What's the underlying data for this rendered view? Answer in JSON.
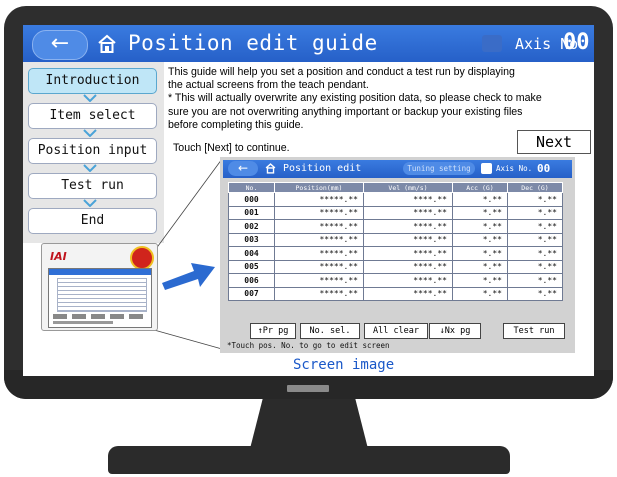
{
  "header": {
    "back_glyph": "←",
    "title": "Position edit guide",
    "axis_label": "Axis No.",
    "axis_no": "00"
  },
  "sidebar": {
    "steps": [
      {
        "label": "Introduction",
        "active": true
      },
      {
        "label": "Item select",
        "active": false
      },
      {
        "label": "Position input",
        "active": false
      },
      {
        "label": "Test run",
        "active": false
      },
      {
        "label": "End",
        "active": false
      }
    ]
  },
  "guide": {
    "line1": "This guide will help you set a position and conduct a test run by displaying",
    "line2": "the actual screens from the teach pendant.",
    "line3": "* This will actually overwrite any existing position data, so please check to make",
    "line4": "sure you are not overwriting anything important or backup your existing files",
    "line5": "before completing this guide.",
    "touch": "Touch [Next] to continue.",
    "next_label": "Next"
  },
  "pendant": {
    "brand": "IAI"
  },
  "preview": {
    "back_glyph": "←",
    "title": "Position edit",
    "tuning": "Tuning setting",
    "axis_label": "Axis No.",
    "axis_no": "00",
    "columns": [
      "No.",
      "Position(mm)",
      "Vel (mm/s)",
      "Acc (G)",
      "Dec (G)"
    ],
    "rows": [
      [
        "000",
        "*****.**",
        "****.**",
        "*.**",
        "*.**"
      ],
      [
        "001",
        "*****.**",
        "****.**",
        "*.**",
        "*.**"
      ],
      [
        "002",
        "*****.**",
        "****.**",
        "*.**",
        "*.**"
      ],
      [
        "003",
        "*****.**",
        "****.**",
        "*.**",
        "*.**"
      ],
      [
        "004",
        "*****.**",
        "****.**",
        "*.**",
        "*.**"
      ],
      [
        "005",
        "*****.**",
        "****.**",
        "*.**",
        "*.**"
      ],
      [
        "006",
        "*****.**",
        "****.**",
        "*.**",
        "*.**"
      ],
      [
        "007",
        "*****.**",
        "****.**",
        "*.**",
        "*.**"
      ]
    ],
    "buttons": {
      "prev_page": "↑Pr pg",
      "no_sel": "No. sel.",
      "all_clear": "All clear",
      "next_page": "↓Nx pg",
      "test_run": "Test run"
    },
    "note": "*Touch pos. No. to go to edit screen"
  },
  "screen_image_label": "Screen image",
  "colors": {
    "title_blue": "#2f6fd6",
    "active_step": "#bfe6f7",
    "label_blue": "#1a58c8",
    "bezel": "#2e2e2e"
  }
}
